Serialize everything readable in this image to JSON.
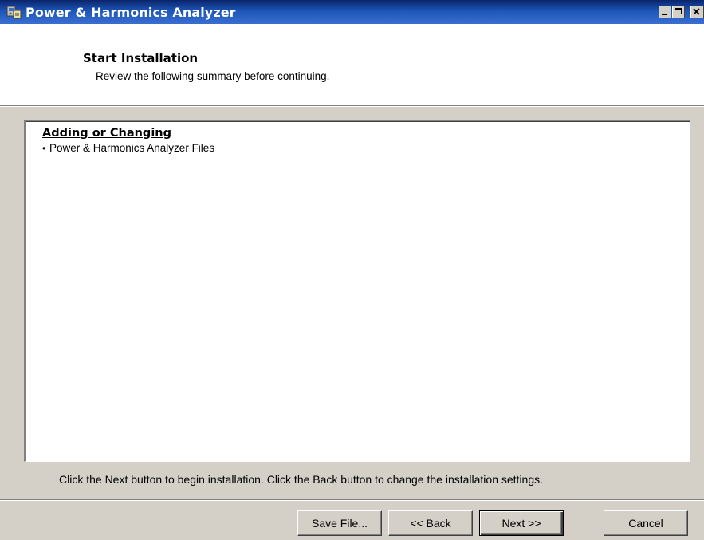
{
  "window": {
    "title": "Power & Harmonics Analyzer",
    "icon": "installer-app-icon",
    "controls": [
      "minimize-icon",
      "maximize-icon",
      "close-icon"
    ]
  },
  "header": {
    "title": "Start Installation",
    "subtitle": "Review the following summary before continuing."
  },
  "summary": {
    "heading": "Adding or Changing",
    "items": [
      "Power & Harmonics Analyzer Files"
    ]
  },
  "instruction": "Click the Next button to begin installation.  Click the Back button to change the installation settings.",
  "buttons": {
    "save_file": "Save File...",
    "back": "<< Back",
    "next": "Next >>",
    "cancel": "Cancel"
  },
  "colors": {
    "titlebar_start": "#0a246a",
    "titlebar_end": "#3a6fd0",
    "dialog_face": "#d4d0c8",
    "panel_bg": "#ffffff"
  }
}
